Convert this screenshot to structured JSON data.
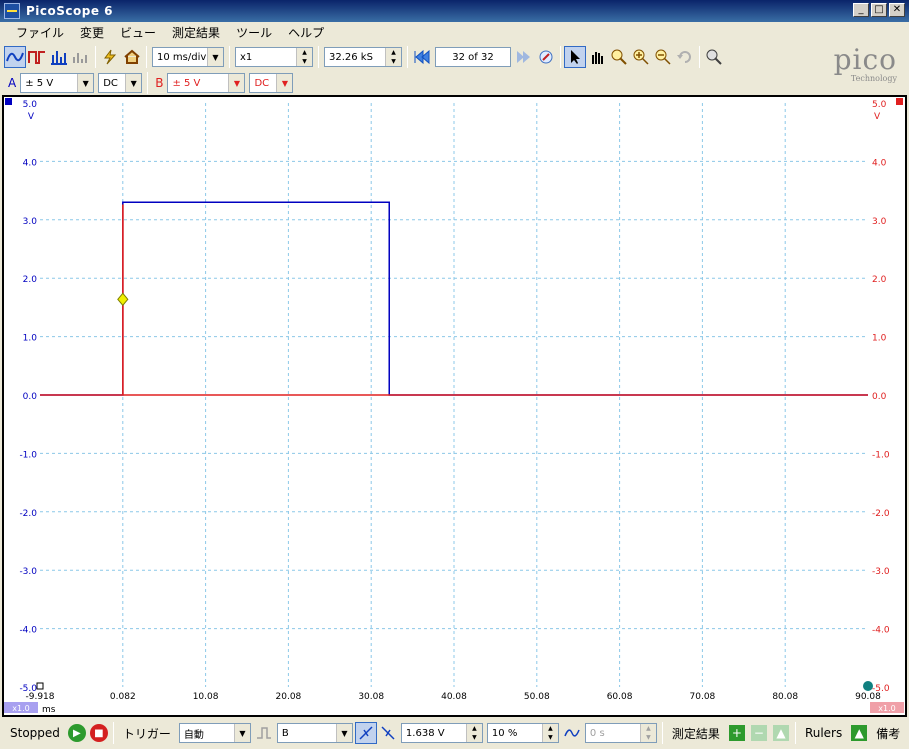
{
  "window": {
    "title": "PicoScope 6"
  },
  "window_buttons": {
    "minimize": "_",
    "maximize": "□",
    "close": "✕"
  },
  "menu": [
    "ファイル",
    "変更",
    "ビュー",
    "測定結果",
    "ツール",
    "ヘルプ"
  ],
  "toolbar": {
    "timebase": "10 ms/div",
    "zoom": "x1",
    "samples": "32.26 kS",
    "buffer": "32 of 32"
  },
  "channels": {
    "a": {
      "label": "A",
      "range": "± 5 V",
      "coupling": "DC",
      "color": "#0000c0"
    },
    "b": {
      "label": "B",
      "range": "± 5 V",
      "coupling": "DC",
      "color": "#e02020"
    }
  },
  "logo": {
    "name": "pico",
    "subtitle": "Technology"
  },
  "chart_data": {
    "type": "line",
    "x_unit": "ms",
    "x_ticks": [
      "-9.918",
      "0.082",
      "10.08",
      "20.08",
      "30.08",
      "40.08",
      "50.08",
      "60.08",
      "70.08",
      "80.08",
      "90.08"
    ],
    "y_ticks_left": [
      "5.0",
      "4.0",
      "3.0",
      "2.0",
      "1.0",
      "0.0",
      "-1.0",
      "-2.0",
      "-3.0",
      "-4.0",
      "-5.0"
    ],
    "y_ticks_right": [
      "5.0",
      "4.0",
      "3.0",
      "2.0",
      "1.0",
      "0.0",
      "-1.0",
      "-2.0",
      "-3.0",
      "-4.0",
      "-5.0"
    ],
    "y_unit_left": "V",
    "y_unit_right": "V",
    "xlim": [
      -9.918,
      90.08
    ],
    "ylim": [
      -5,
      5
    ],
    "grid": true,
    "series": [
      {
        "name": "A",
        "color": "#0000c0",
        "x": [
          -9.918,
          0.082,
          0.082,
          32.26,
          32.26,
          90.08
        ],
        "y": [
          0,
          0,
          3.3,
          3.3,
          0,
          0
        ]
      },
      {
        "name": "B",
        "color": "#e02020",
        "x": [
          -9.918,
          0.082,
          0.082,
          0.1,
          0.1,
          90.08
        ],
        "y": [
          0,
          0,
          3.25,
          3.25,
          0,
          0
        ]
      }
    ],
    "trigger_marker": {
      "x": 0.082,
      "y": 1.638
    },
    "left_scale_badge": "x1.0",
    "right_scale_badge": "x1.0"
  },
  "status": {
    "state": "Stopped",
    "trigger_label": "トリガー",
    "trigger_mode": "自動",
    "trigger_source": "B",
    "trigger_level": "1.638 V",
    "pretrigger": "10 %",
    "delay": "0 s",
    "measurements_label": "測定結果",
    "rulers_label": "Rulers",
    "notes_label": "備考"
  }
}
